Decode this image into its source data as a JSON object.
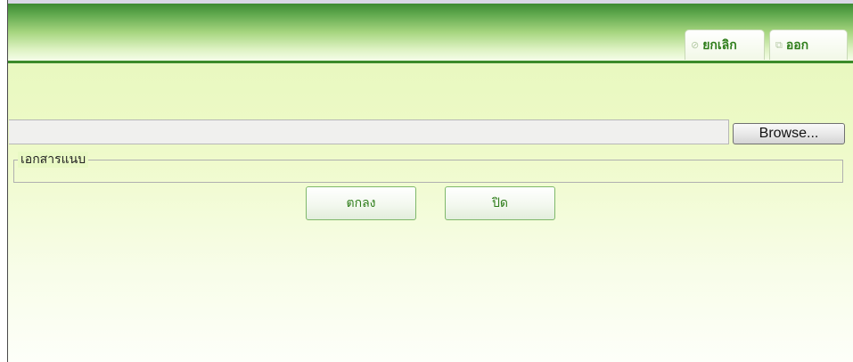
{
  "header": {
    "buttons": [
      {
        "label": "ยกเลิก",
        "icon": "cancel-icon"
      },
      {
        "label": "ออก",
        "icon": "exit-icon"
      }
    ],
    "accent_color": "#3b8b2a"
  },
  "upload": {
    "file_value": "",
    "browse_label": "Browse..."
  },
  "attachment": {
    "legend": "เอกสารแนบ"
  },
  "actions": {
    "ok_label": "ตกลง",
    "close_label": "ปิด"
  }
}
